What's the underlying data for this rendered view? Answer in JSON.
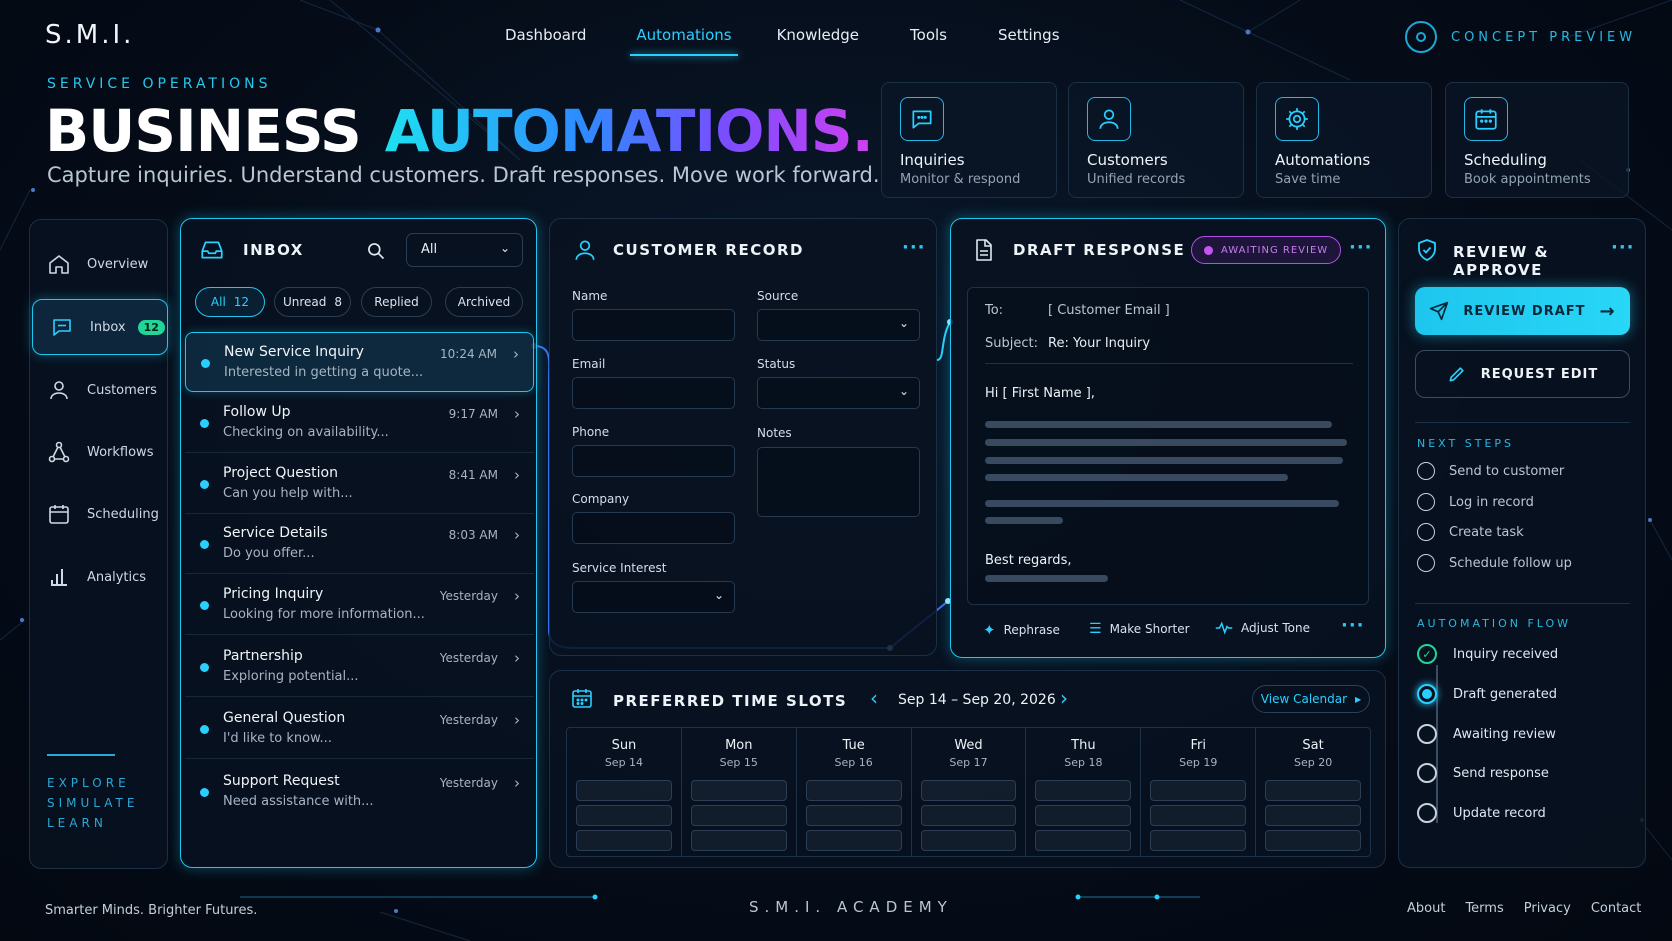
{
  "brand": {
    "logo": "S.M.I.",
    "concept": "CONCEPT PREVIEW",
    "accent": "#29d0ff"
  },
  "nav": [
    "Dashboard",
    "Automations",
    "Knowledge",
    "Tools",
    "Settings"
  ],
  "hero": {
    "eyebrow": "SERVICE OPERATIONS",
    "title_1": "BUSINESS",
    "title_2": "AUTOMATIONS.",
    "tagline": "Capture inquiries. Understand customers. Draft responses. Move work forward."
  },
  "features": [
    {
      "title": "Inquiries",
      "sub": "Monitor & respond",
      "icon": "chat-icon"
    },
    {
      "title": "Customers",
      "sub": "Unified records",
      "icon": "user-icon"
    },
    {
      "title": "Automations",
      "sub": "Save time",
      "icon": "gear-icon"
    },
    {
      "title": "Scheduling",
      "sub": "Book appointments",
      "icon": "calendar-icon"
    }
  ],
  "sidebar": {
    "items": [
      {
        "label": "Overview",
        "icon": "home-icon"
      },
      {
        "label": "Inbox",
        "icon": "chat-icon",
        "badge": "12"
      },
      {
        "label": "Customers",
        "icon": "user-icon"
      },
      {
        "label": "Workflows",
        "icon": "workflow-icon"
      },
      {
        "label": "Scheduling",
        "icon": "calendar-icon"
      },
      {
        "label": "Analytics",
        "icon": "bar-chart-icon"
      }
    ],
    "explore": [
      "EXPLORE",
      "SIMULATE",
      "LEARN"
    ]
  },
  "inbox": {
    "title": "INBOX",
    "filter": "All",
    "chips": [
      {
        "label": "All",
        "count": "12"
      },
      {
        "label": "Unread",
        "count": "8"
      },
      {
        "label": "Replied",
        "count": ""
      },
      {
        "label": "Archived",
        "count": ""
      }
    ],
    "messages": [
      {
        "title": "New Service Inquiry",
        "snippet": "Interested in getting a quote...",
        "time": "10:24 AM"
      },
      {
        "title": "Follow Up",
        "snippet": "Checking on availability...",
        "time": "9:17 AM"
      },
      {
        "title": "Project Question",
        "snippet": "Can you help with...",
        "time": "8:41 AM"
      },
      {
        "title": "Service Details",
        "snippet": "Do you offer...",
        "time": "8:03 AM"
      },
      {
        "title": "Pricing Inquiry",
        "snippet": "Looking for more information...",
        "time": "Yesterday"
      },
      {
        "title": "Partnership",
        "snippet": "Exploring potential...",
        "time": "Yesterday"
      },
      {
        "title": "General Question",
        "snippet": "I'd like to know...",
        "time": "Yesterday"
      },
      {
        "title": "Support Request",
        "snippet": "Need assistance with...",
        "time": "Yesterday"
      }
    ]
  },
  "customer": {
    "title": "CUSTOMER RECORD",
    "fields": {
      "name": "Name",
      "source": "Source",
      "email": "Email",
      "status": "Status",
      "phone": "Phone",
      "notes": "Notes",
      "company": "Company",
      "service": "Service Interest"
    }
  },
  "draft": {
    "title": "DRAFT RESPONSE",
    "status": "AWAITING REVIEW",
    "to_label": "To:",
    "to_value": "[ Customer Email ]",
    "subject_label": "Subject:",
    "subject_value": "Re: Your Inquiry",
    "greeting": "Hi [ First Name ],",
    "signoff": "Best regards,",
    "tools": [
      "Rephrase",
      "Make Shorter",
      "Adjust Tone"
    ]
  },
  "review": {
    "title": "REVIEW & APPROVE",
    "review_btn": "REVIEW DRAFT",
    "edit_btn": "REQUEST EDIT",
    "next_steps_title": "NEXT STEPS",
    "next_steps": [
      "Send to customer",
      "Log in record",
      "Create task",
      "Schedule follow up"
    ],
    "flow_title": "AUTOMATION FLOW",
    "flow": [
      "Inquiry received",
      "Draft generated",
      "Awaiting review",
      "Send response",
      "Update record"
    ]
  },
  "slots": {
    "title": "PREFERRED TIME SLOTS",
    "range": "Sep 14 – Sep 20, 2026",
    "view_btn": "View Calendar",
    "days": [
      {
        "name": "Sun",
        "date": "Sep 14"
      },
      {
        "name": "Mon",
        "date": "Sep 15"
      },
      {
        "name": "Tue",
        "date": "Sep 16"
      },
      {
        "name": "Wed",
        "date": "Sep 17"
      },
      {
        "name": "Thu",
        "date": "Sep 18"
      },
      {
        "name": "Fri",
        "date": "Sep 19"
      },
      {
        "name": "Sat",
        "date": "Sep 20"
      }
    ]
  },
  "footer": {
    "motto": "Smarter Minds. Brighter Futures.",
    "academy": "S.M.I. ACADEMY",
    "links": [
      "About",
      "Terms",
      "Privacy",
      "Contact"
    ]
  }
}
